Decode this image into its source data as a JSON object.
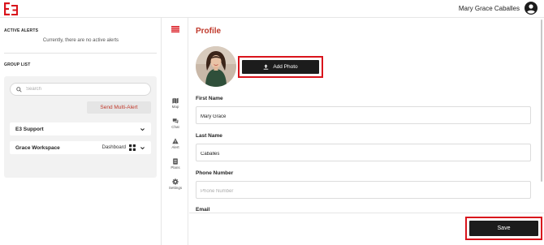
{
  "header": {
    "user_name": "Mary Grace Caballes",
    "logo_icon": "e3-logo",
    "accent": "#d9141c"
  },
  "sidebar": {
    "active_alerts_title": "ACTIVE ALERTS",
    "no_alerts_text": "Currently, there are no active alerts",
    "group_list_title": "GROUP LIST",
    "search_placeholder": "Search",
    "send_multi_alert": "Send Multi-Alert",
    "groups": [
      {
        "name": "E3 Support"
      },
      {
        "name": "Grace Workspace",
        "dashboard_label": "Dashboard"
      }
    ]
  },
  "rail": {
    "items": [
      {
        "label": "Map",
        "icon": "map-icon"
      },
      {
        "label": "Chat",
        "icon": "chat-icon"
      },
      {
        "label": "Alert",
        "icon": "alert-icon"
      },
      {
        "label": "Plans",
        "icon": "plans-icon"
      },
      {
        "label": "Settings",
        "icon": "gear-icon"
      }
    ]
  },
  "profile": {
    "title": "Profile",
    "add_photo": "Add Photo",
    "first_name_label": "First Name",
    "first_name_value": "Mary Grace",
    "last_name_label": "Last Name",
    "last_name_value": "Caballes",
    "phone_label": "Phone Number",
    "phone_placeholder": "Phone Number",
    "email_label": "Email",
    "save": "Save"
  }
}
